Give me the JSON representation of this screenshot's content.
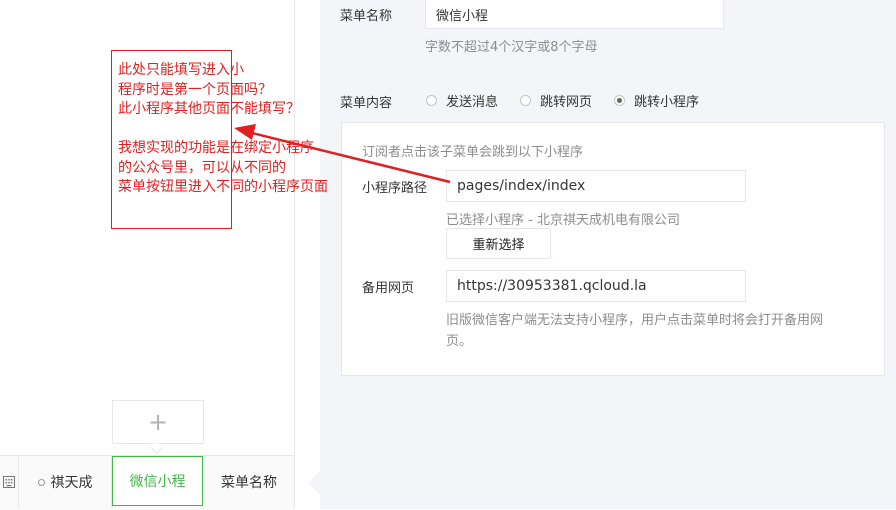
{
  "preview": {
    "add_icon": "plus-icon",
    "keyboard_icon": "keyboard-icon",
    "menu_items": [
      {
        "label": "祺天成",
        "has_sub_dot": true
      },
      {
        "label": "微信小程",
        "selected": true
      },
      {
        "label": "菜单名称"
      }
    ]
  },
  "editor": {
    "menu_name_label": "菜单名称",
    "menu_name_value": "微信小程",
    "menu_name_tip": "字数不超过4个汉字或8个字母",
    "menu_content_label": "菜单内容",
    "radios": [
      {
        "label": "发送消息",
        "checked": false
      },
      {
        "label": "跳转网页",
        "checked": false
      },
      {
        "label": "跳转小程序",
        "checked": true
      }
    ],
    "panel": {
      "intro": "订阅者点击该子菜单会跳到以下小程序",
      "path_label": "小程序路径",
      "path_value": "pages/index/index",
      "selected_tip": "已选择小程序 - 北京祺天成机电有限公司",
      "reselect_button": "重新选择",
      "backup_label": "备用网页",
      "backup_value": "https://30953381.qcloud.la",
      "backup_tip_line1": "旧版微信客户端无法支持小程序，用户点击菜单时将会打开备用网",
      "backup_tip_line2": "页。"
    }
  },
  "annotation": {
    "color": "#e02020",
    "text": "此处只能填写进入小\n程序时是第一个页面吗？\n此小程序其他页面不能填写？\n\n我想实现的功能是在绑定小程序\n的公众号里，可以从不同的\n菜单按钮里进入不同的小程序页面"
  },
  "colors": {
    "accent_green": "#44b549",
    "editor_bg": "#f4f5f9"
  }
}
